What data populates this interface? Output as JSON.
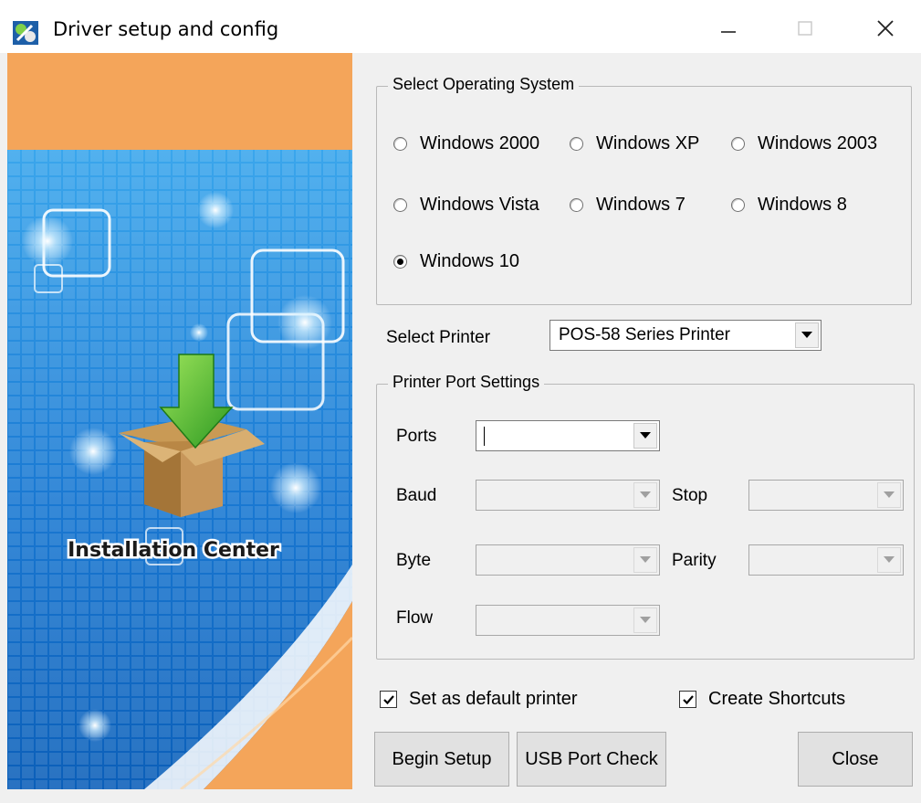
{
  "window": {
    "title": "Driver setup and config"
  },
  "banner": {
    "caption": "Installation Center"
  },
  "os_group": {
    "label": "Select Operating System",
    "options": [
      {
        "label": "Windows 2000",
        "selected": false
      },
      {
        "label": "Windows XP",
        "selected": false
      },
      {
        "label": "Windows 2003",
        "selected": false
      },
      {
        "label": "Windows Vista",
        "selected": false
      },
      {
        "label": "Windows 7",
        "selected": false
      },
      {
        "label": "Windows 8",
        "selected": false
      },
      {
        "label": "Windows 10",
        "selected": true
      }
    ]
  },
  "printer": {
    "label": "Select Printer",
    "value": "POS-58 Series Printer"
  },
  "port_group": {
    "label": "Printer Port Settings",
    "ports_label": "Ports",
    "ports_value": "",
    "baud_label": "Baud",
    "baud_value": "",
    "stop_label": "Stop",
    "stop_value": "",
    "byte_label": "Byte",
    "byte_value": "",
    "parity_label": "Parity",
    "parity_value": "",
    "flow_label": "Flow",
    "flow_value": ""
  },
  "options": {
    "default_printer": {
      "label": "Set as default printer",
      "checked": true
    },
    "shortcuts": {
      "label": "Create Shortcuts",
      "checked": true
    }
  },
  "buttons": {
    "begin": "Begin Setup",
    "usb": "USB Port Check",
    "close": "Close"
  },
  "icons": {
    "app": "setup-app-icon",
    "minimize": "minimize-icon",
    "maximize": "maximize-icon",
    "close": "close-icon",
    "dropdown": "chevron-down-icon"
  },
  "colors": {
    "accent_orange": "#f2a65a",
    "banner_blue": "#1f7fd6",
    "window_bg": "#f0f0f0"
  }
}
